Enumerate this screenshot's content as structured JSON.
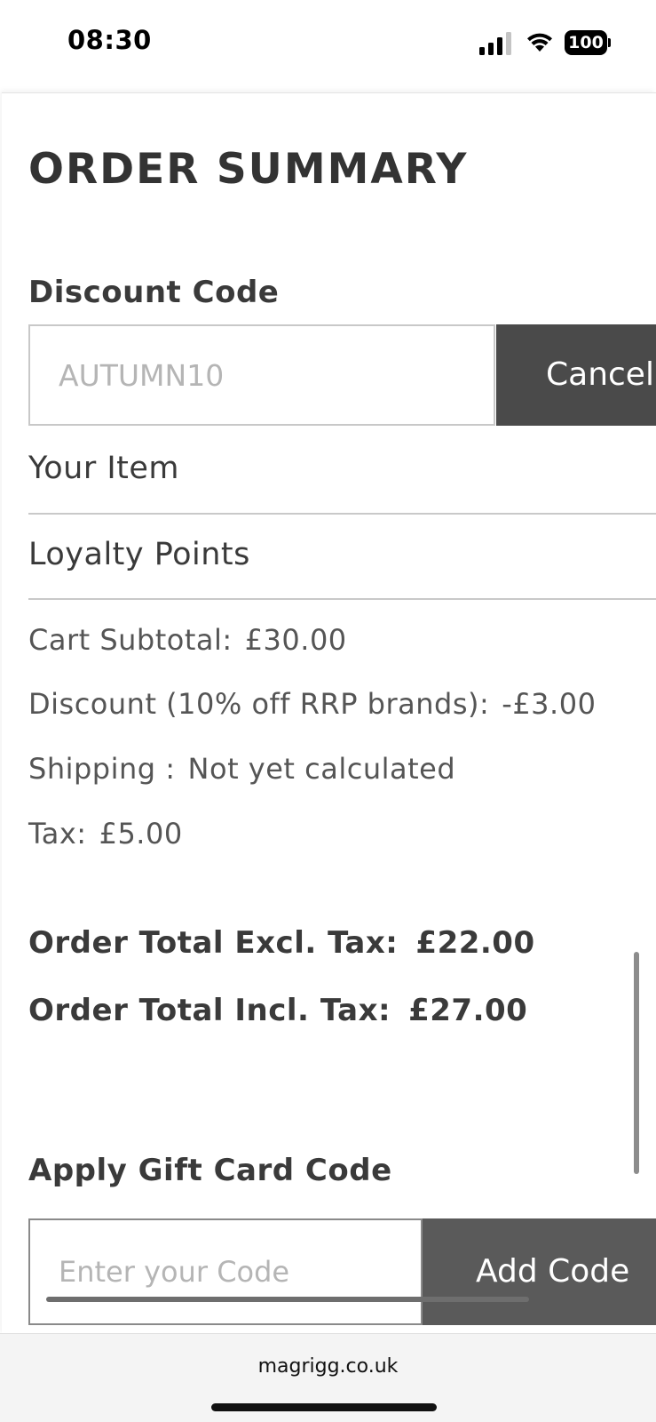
{
  "status_bar": {
    "time": "08:30",
    "battery": "100"
  },
  "order_summary": {
    "title": "ORDER SUMMARY",
    "discount": {
      "label": "Discount Code",
      "input_value": "AUTUMN10",
      "button_label": "Cancel"
    },
    "sections": {
      "your_item": "Your Item",
      "loyalty_points": "Loyalty Points"
    },
    "lines": [
      {
        "label": "Cart Subtotal:",
        "value": "£30.00"
      },
      {
        "label": "Discount (10% off RRP brands):",
        "value": "-£3.00"
      },
      {
        "label": "Shipping :",
        "value": "Not yet calculated"
      },
      {
        "label": "Tax:",
        "value": "£5.00"
      }
    ],
    "totals": [
      {
        "label": "Order Total Excl. Tax:",
        "value": "£22.00"
      },
      {
        "label": "Order Total Incl. Tax:",
        "value": "£27.00"
      }
    ],
    "gift_card": {
      "label": "Apply Gift Card Code",
      "placeholder": "Enter your Code",
      "button_label": "Add Code"
    }
  },
  "browser": {
    "url": "magrigg.co.uk"
  }
}
